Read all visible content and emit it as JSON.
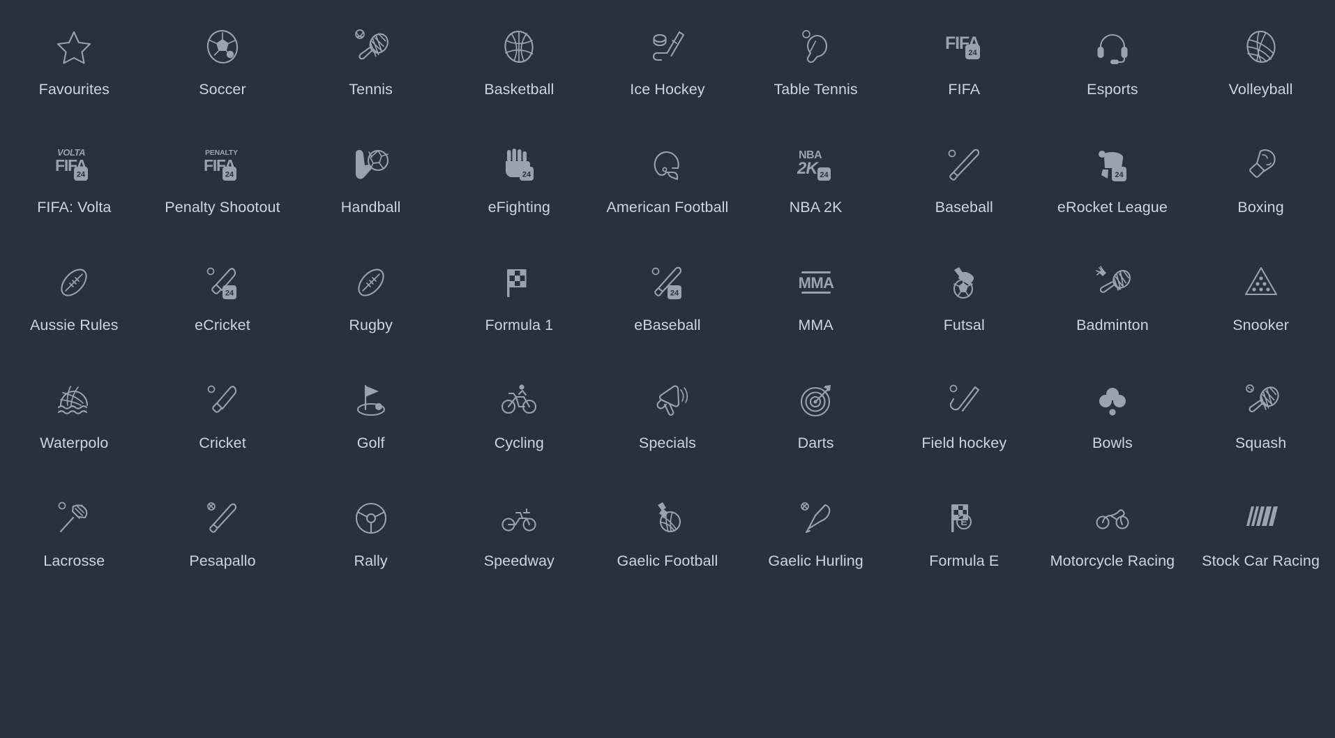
{
  "page": {
    "background_color": "#28323c",
    "label_color": "#cfd4da",
    "icon_color": "#9aa3ac",
    "columns": 9,
    "rows": 5
  },
  "categories": [
    {
      "label": "Favourites",
      "icon": "star-icon"
    },
    {
      "label": "Soccer",
      "icon": "soccer-ball-icon"
    },
    {
      "label": "Tennis",
      "icon": "tennis-racket-icon"
    },
    {
      "label": "Basketball",
      "icon": "basketball-icon"
    },
    {
      "label": "Ice Hockey",
      "icon": "ice-hockey-stick-puck-icon"
    },
    {
      "label": "Table Tennis",
      "icon": "table-tennis-paddle-icon"
    },
    {
      "label": "FIFA",
      "icon": "fifa-24-logo-icon",
      "logo_lines": [
        "FIFA"
      ],
      "badge": "24"
    },
    {
      "label": "Esports",
      "icon": "headset-icon"
    },
    {
      "label": "Volleyball",
      "icon": "volleyball-icon"
    },
    {
      "label": "FIFA: Volta",
      "icon": "fifa-volta-24-logo-icon",
      "logo_lines": [
        "VOLTA",
        "FIFA"
      ],
      "badge": "24"
    },
    {
      "label": "Penalty Shootout",
      "icon": "penalty-fifa-24-logo-icon",
      "logo_lines": [
        "PENALTY",
        "FIFA"
      ],
      "badge": "24"
    },
    {
      "label": "Handball",
      "icon": "handball-icon"
    },
    {
      "label": "eFighting",
      "icon": "efighting-fist-24-icon",
      "badge": "24"
    },
    {
      "label": "American Football",
      "icon": "american-football-helmet-icon"
    },
    {
      "label": "NBA 2K",
      "icon": "nba-2k-24-logo-icon",
      "logo_lines": [
        "NBA",
        "2K"
      ],
      "badge": "24"
    },
    {
      "label": "Baseball",
      "icon": "baseball-bat-ball-icon"
    },
    {
      "label": "eRocket League",
      "icon": "erocket-league-24-icon",
      "badge": "24"
    },
    {
      "label": "Boxing",
      "icon": "boxing-glove-icon"
    },
    {
      "label": "Aussie Rules",
      "icon": "aussie-rules-ball-icon"
    },
    {
      "label": "eCricket",
      "icon": "ecricket-bat-24-icon",
      "badge": "24"
    },
    {
      "label": "Rugby",
      "icon": "rugby-ball-icon"
    },
    {
      "label": "Formula 1",
      "icon": "checkered-flag-icon"
    },
    {
      "label": "eBaseball",
      "icon": "ebaseball-bat-24-icon",
      "badge": "24"
    },
    {
      "label": "MMA",
      "icon": "mma-logo-icon",
      "logo_lines": [
        "MMA"
      ]
    },
    {
      "label": "Futsal",
      "icon": "futsal-boot-ball-icon"
    },
    {
      "label": "Badminton",
      "icon": "badminton-racket-shuttlecock-icon"
    },
    {
      "label": "Snooker",
      "icon": "snooker-triangle-balls-icon"
    },
    {
      "label": "Waterpolo",
      "icon": "waterpolo-ball-waves-icon"
    },
    {
      "label": "Cricket",
      "icon": "cricket-bat-ball-icon"
    },
    {
      "label": "Golf",
      "icon": "golf-flag-hole-icon"
    },
    {
      "label": "Cycling",
      "icon": "cycling-bicycle-icon"
    },
    {
      "label": "Specials",
      "icon": "megaphone-icon"
    },
    {
      "label": "Darts",
      "icon": "darts-target-icon"
    },
    {
      "label": "Field hockey",
      "icon": "field-hockey-stick-ball-icon"
    },
    {
      "label": "Bowls",
      "icon": "lawn-bowls-icon"
    },
    {
      "label": "Squash",
      "icon": "squash-racket-ball-icon"
    },
    {
      "label": "Lacrosse",
      "icon": "lacrosse-stick-ball-icon"
    },
    {
      "label": "Pesapallo",
      "icon": "pesapallo-bat-ball-icon"
    },
    {
      "label": "Rally",
      "icon": "steering-wheel-icon"
    },
    {
      "label": "Speedway",
      "icon": "speedway-motorcycle-icon"
    },
    {
      "label": "Gaelic Football",
      "icon": "gaelic-football-icon"
    },
    {
      "label": "Gaelic Hurling",
      "icon": "gaelic-hurling-stick-ball-icon"
    },
    {
      "label": "Formula E",
      "icon": "formula-e-flag-icon",
      "logo_lines": [
        "E"
      ]
    },
    {
      "label": "Motorcycle Racing",
      "icon": "motorcycle-racing-icon"
    },
    {
      "label": "Stock Car Racing",
      "icon": "stock-car-racing-stripes-icon"
    }
  ]
}
